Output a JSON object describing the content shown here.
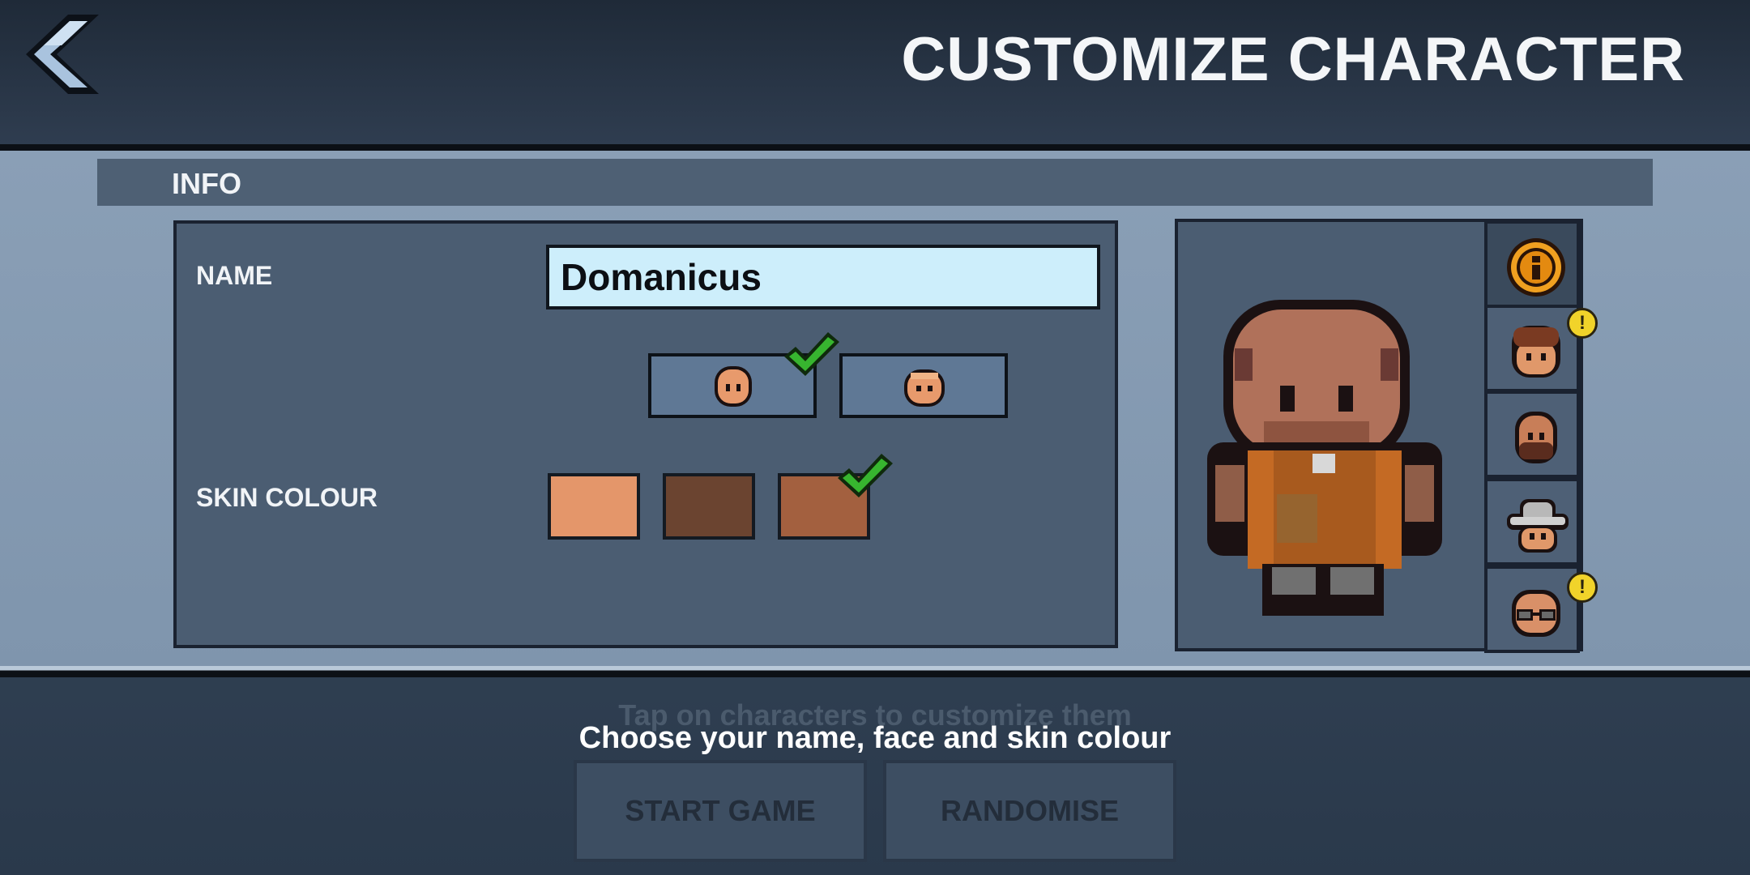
{
  "header": {
    "title": "CUSTOMIZE CHARACTER",
    "back_icon": "chevron-left-icon"
  },
  "info": {
    "section_label": "INFO",
    "name_label": "NAME",
    "name_value": "Domanicus",
    "skin_label": "SKIN COLOUR",
    "faces": [
      {
        "selected": true
      },
      {
        "selected": false
      }
    ],
    "skin_colours": [
      {
        "color": "#e4966a",
        "selected": false
      },
      {
        "color": "#6b4430",
        "selected": false
      },
      {
        "color": "#a3603f",
        "selected": true
      }
    ]
  },
  "character_tabs": [
    {
      "icon": "info-icon",
      "active": true,
      "alert": false
    },
    {
      "icon": "curly-hair-head-icon",
      "active": false,
      "alert": true
    },
    {
      "icon": "bearded-head-icon",
      "active": false,
      "alert": false
    },
    {
      "icon": "hat-head-icon",
      "active": false,
      "alert": false
    },
    {
      "icon": "glasses-head-icon",
      "active": false,
      "alert": true
    }
  ],
  "footer": {
    "hint_faded": "Tap on characters to customize them",
    "hint": "Choose your name, face and skin colour",
    "start_label": "START GAME",
    "randomise_label": "RANDOMISE"
  },
  "colors": {
    "check": "#2fa52a",
    "alert": "#f1d32a",
    "input_bg": "#cdeefb"
  }
}
